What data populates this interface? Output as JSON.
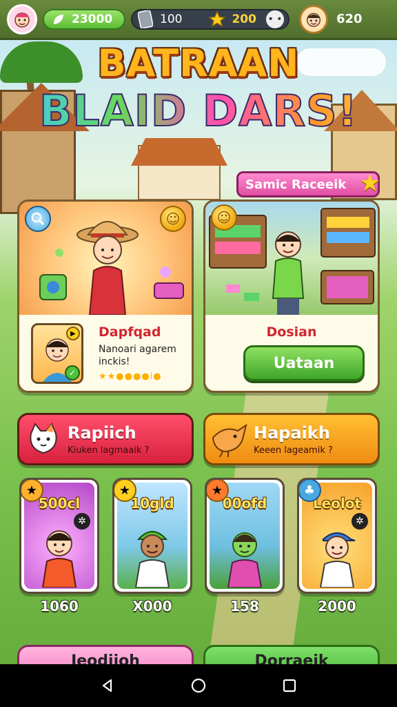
{
  "topbar": {
    "gems": "23000",
    "cards": "100",
    "stars": "200",
    "coins": "620"
  },
  "title": {
    "line1": "BATRAAN",
    "line2": "BLAID DARS!"
  },
  "ribbon": {
    "label": "Samic Raceeik"
  },
  "left_card": {
    "name": "Dapfqad",
    "description": "Nanoari agarem inckis!",
    "rating": "★★●●●●i●"
  },
  "right_card": {
    "name": "Dosian",
    "button": "Uataan"
  },
  "wide_buttons": [
    {
      "title": "Rapiich",
      "subtitle": "Kiuken lagmaaik ?"
    },
    {
      "title": "Hapaikh",
      "subtitle": "Keeen lageamik ?"
    }
  ],
  "characters": [
    {
      "label": "500cl",
      "price": "1060",
      "bg": "#d35cd6"
    },
    {
      "label": "10gld",
      "price": "X000",
      "bg": "#8ed0ef"
    },
    {
      "label": "00ofd",
      "price": "158",
      "bg": "#7ec4e8"
    },
    {
      "label": "Leolot",
      "price": "2000",
      "bg": "#ffb43a"
    }
  ],
  "bottom_buttons": [
    {
      "label": "Ieodiioh"
    },
    {
      "label": "Dorraeik"
    }
  ],
  "colors": {
    "accent_green": "#5cbd35",
    "accent_red": "#d8213e",
    "accent_orange": "#f08c12",
    "gold": "#ffd23a"
  }
}
